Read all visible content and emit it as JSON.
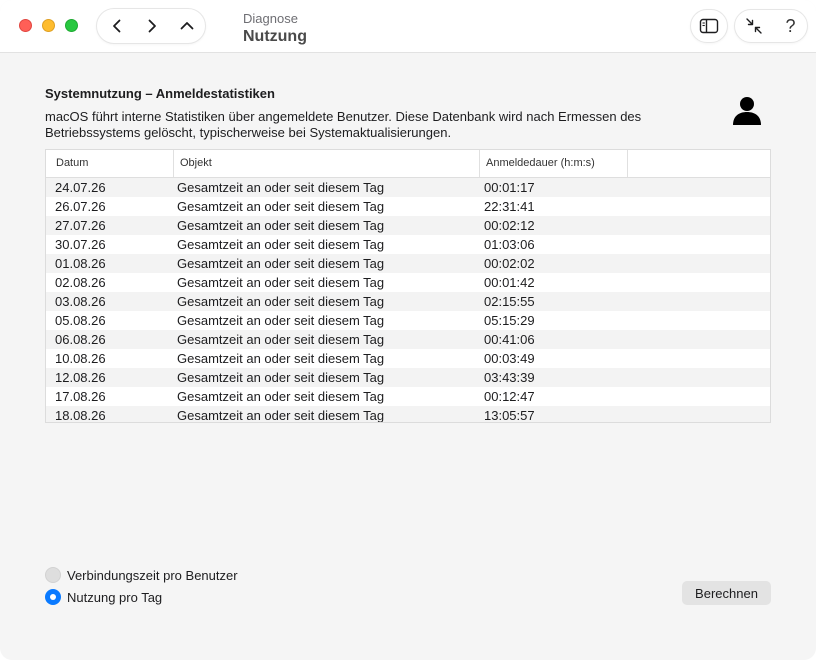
{
  "window": {
    "subtitle": "Diagnose",
    "title": "Nutzung"
  },
  "toolbar": {
    "back_icon": "chevron-left-icon",
    "forward_icon": "chevron-right-icon",
    "up_icon": "chevron-up-icon",
    "sidebar_icon": "sidebar-icon",
    "collapse_icon": "collapse-arrows-icon",
    "help_label": "?"
  },
  "main": {
    "section_title": "Systemnutzung – Anmeldestatistiken",
    "description": "macOS führt interne Statistiken über angemeldete Benutzer. Diese Datenbank wird nach Ermessen des Betriebssystems gelöscht, typischerweise bei Systemaktualisierungen.",
    "user_icon": "user-icon"
  },
  "table": {
    "columns": [
      "Datum",
      "Objekt",
      "Anmeldedauer (h:m:s)"
    ],
    "rows": [
      {
        "date": "24.07.26",
        "object": "Gesamtzeit an oder seit diesem Tag",
        "duration": "00:01:17"
      },
      {
        "date": "26.07.26",
        "object": "Gesamtzeit an oder seit diesem Tag",
        "duration": "22:31:41"
      },
      {
        "date": "27.07.26",
        "object": "Gesamtzeit an oder seit diesem Tag",
        "duration": "00:02:12"
      },
      {
        "date": "30.07.26",
        "object": "Gesamtzeit an oder seit diesem Tag",
        "duration": "01:03:06"
      },
      {
        "date": "01.08.26",
        "object": "Gesamtzeit an oder seit diesem Tag",
        "duration": "00:02:02"
      },
      {
        "date": "02.08.26",
        "object": "Gesamtzeit an oder seit diesem Tag",
        "duration": "00:01:42"
      },
      {
        "date": "03.08.26",
        "object": "Gesamtzeit an oder seit diesem Tag",
        "duration": "02:15:55"
      },
      {
        "date": "05.08.26",
        "object": "Gesamtzeit an oder seit diesem Tag",
        "duration": "05:15:29"
      },
      {
        "date": "06.08.26",
        "object": "Gesamtzeit an oder seit diesem Tag",
        "duration": "00:41:06"
      },
      {
        "date": "10.08.26",
        "object": "Gesamtzeit an oder seit diesem Tag",
        "duration": "00:03:49"
      },
      {
        "date": "12.08.26",
        "object": "Gesamtzeit an oder seit diesem Tag",
        "duration": "03:43:39"
      },
      {
        "date": "17.08.26",
        "object": "Gesamtzeit an oder seit diesem Tag",
        "duration": "00:12:47"
      },
      {
        "date": "18.08.26",
        "object": "Gesamtzeit an oder seit diesem Tag",
        "duration": "13:05:57"
      }
    ]
  },
  "options": {
    "per_user_label": "Verbindungszeit pro Benutzer",
    "per_user_selected": false,
    "per_day_label": "Nutzung pro Tag",
    "per_day_selected": true
  },
  "actions": {
    "calculate_label": "Berechnen"
  },
  "colors": {
    "accent": "#0a7aff",
    "close": "#ff5f57",
    "minimize": "#febc2e",
    "maximize": "#28c840"
  }
}
